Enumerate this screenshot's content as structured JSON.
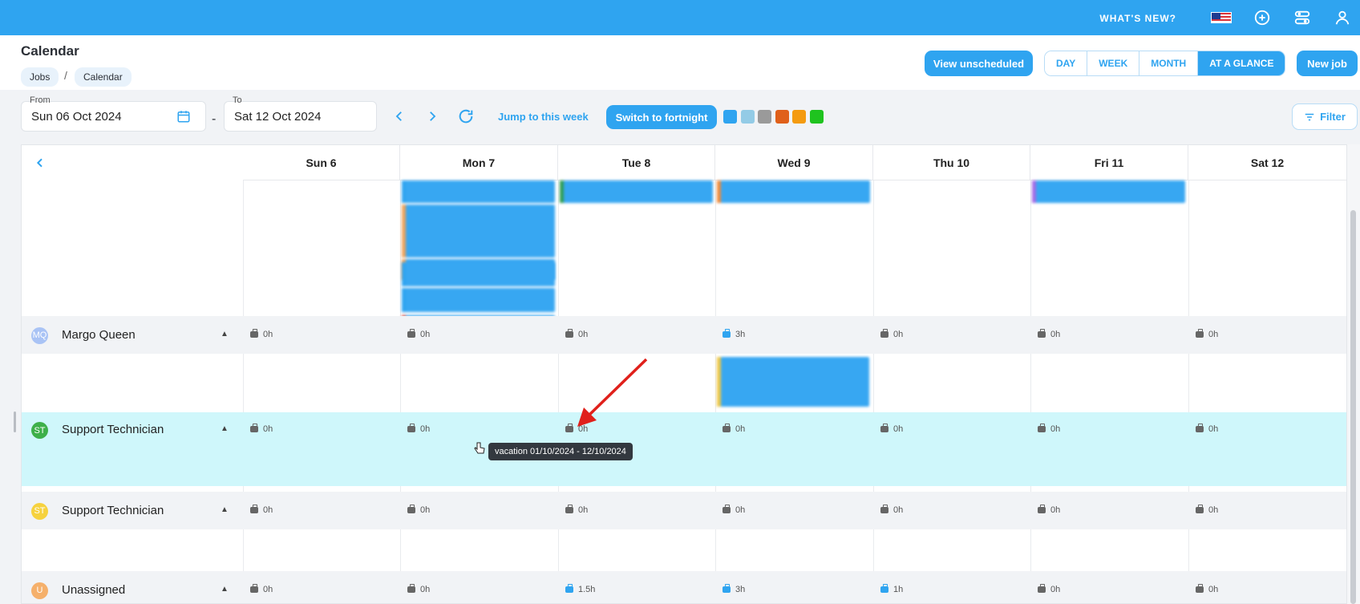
{
  "topbar": {
    "whats_new": "WHAT'S NEW?"
  },
  "header": {
    "title": "Calendar",
    "breadcrumb": [
      "Jobs",
      "Calendar"
    ],
    "view_unscheduled": "View unscheduled",
    "views": [
      "DAY",
      "WEEK",
      "MONTH",
      "AT A GLANCE"
    ],
    "active_view": "AT A GLANCE",
    "new_job": "New job"
  },
  "toolbar": {
    "from_label": "From",
    "from_value": "Sun 06 Oct 2024",
    "to_label": "To",
    "to_value": "Sat 12 Oct 2024",
    "dash": "-",
    "jump": "Jump to this week",
    "switch": "Switch to fortnight",
    "swatches": [
      "#2fa4f0",
      "#93cbe6",
      "#9a9a9a",
      "#e0601a",
      "#f49b10",
      "#1fc31f"
    ],
    "filter": "Filter"
  },
  "days": [
    "Sun 6",
    "Mon 7",
    "Tue 8",
    "Wed 9",
    "Thu 10",
    "Fri 11",
    "Sat 12"
  ],
  "resources": [
    {
      "initials": "MQ",
      "name": "Margo Queen",
      "avatar_color": "#a9c3f5",
      "hours": [
        "0h",
        "0h",
        "0h",
        "3h",
        "0h",
        "0h",
        "0h"
      ],
      "highlight": [
        false,
        false,
        false,
        true,
        false,
        false,
        false
      ]
    },
    {
      "initials": "ST",
      "name": "Support Technician",
      "avatar_color": "#3db04a",
      "hours": [
        "0h",
        "0h",
        "0h",
        "0h",
        "0h",
        "0h",
        "0h"
      ],
      "highlight": [
        false,
        false,
        false,
        false,
        false,
        false,
        false
      ]
    },
    {
      "initials": "ST",
      "name": "Support Technician",
      "avatar_color": "#f6d23f",
      "hours": [
        "0h",
        "0h",
        "0h",
        "0h",
        "0h",
        "0h",
        "0h"
      ],
      "highlight": [
        false,
        false,
        false,
        false,
        false,
        false,
        false
      ]
    },
    {
      "initials": "U",
      "name": "Unassigned",
      "avatar_color": "#f5b06b",
      "hours": [
        "0h",
        "0h",
        "1.5h",
        "3h",
        "1h",
        "0h",
        "0h"
      ],
      "highlight": [
        false,
        false,
        true,
        true,
        true,
        false,
        false
      ]
    }
  ],
  "tooltip": "vacation 01/10/2024 - 12/10/2024"
}
